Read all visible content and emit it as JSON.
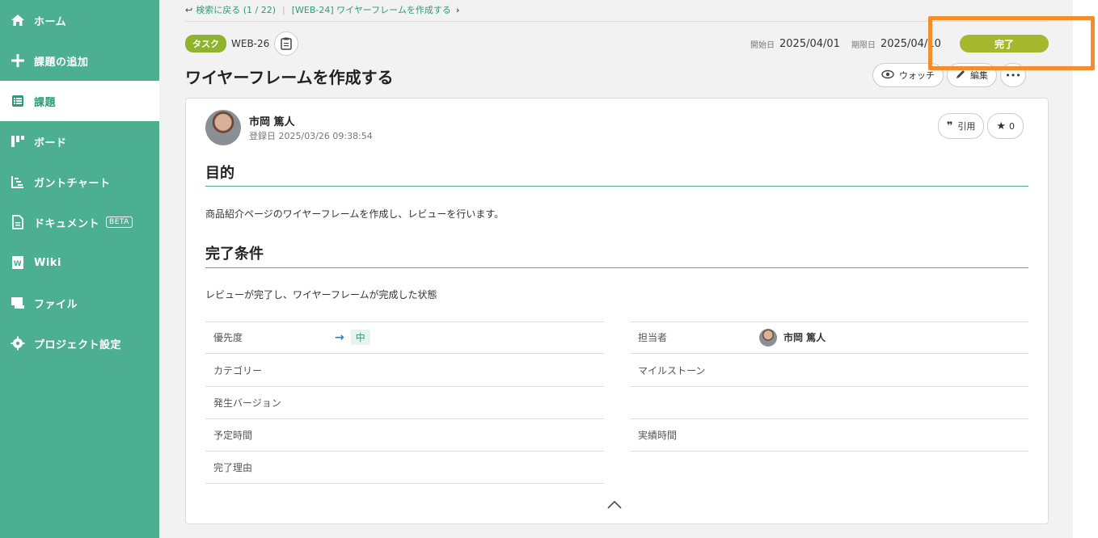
{
  "sidebar": {
    "items": [
      {
        "label": "ホーム",
        "icon": "home-icon"
      },
      {
        "label": "課題の追加",
        "icon": "plus-icon"
      },
      {
        "label": "課題",
        "icon": "list-icon",
        "active": true
      },
      {
        "label": "ボード",
        "icon": "board-icon"
      },
      {
        "label": "ガントチャート",
        "icon": "gantt-icon"
      },
      {
        "label": "ドキュメント",
        "icon": "document-icon",
        "badge": "BETA"
      },
      {
        "label": "Wiki",
        "icon": "wiki-icon"
      },
      {
        "label": "ファイル",
        "icon": "folder-icon"
      },
      {
        "label": "プロジェクト設定",
        "icon": "gear-icon"
      }
    ]
  },
  "breadcrumb": {
    "back": "検索に戻る (1 / 22)",
    "parent": "[WEB-24] ワイヤーフレームを作成する"
  },
  "issue": {
    "type": "タスク",
    "key": "WEB-26",
    "title": "ワイヤーフレームを作成する",
    "start_label": "開始日",
    "start_date": "2025/04/01",
    "due_label": "期限日",
    "due_date": "2025/04/10",
    "status": "完了"
  },
  "actions": {
    "watch": "ウォッチ",
    "edit": "編集",
    "more": "•••"
  },
  "card": {
    "author": "市岡 篤人",
    "registered": "登録日  2025/03/26 09:38:54",
    "quote": "引用",
    "stars": "0",
    "purpose_heading": "目的",
    "purpose_text": "商品紹介ページのワイヤーフレームを作成し、レビューを行います。",
    "done_heading": "完了条件",
    "done_text": "レビューが完了し、ワイヤーフレームが完成した状態"
  },
  "fields": {
    "priority_label": "優先度",
    "priority_value": "中",
    "category_label": "カテゴリー",
    "version_label": "発生バージョン",
    "planned_label": "予定時間",
    "reason_label": "完了理由",
    "assignee_label": "担当者",
    "assignee_value": "市岡 篤人",
    "milestone_label": "マイルストーン",
    "actual_label": "実績時間"
  },
  "colors": {
    "brand": "#4caf8f",
    "status": "#a3b82c",
    "highlight": "#f28f2c"
  }
}
